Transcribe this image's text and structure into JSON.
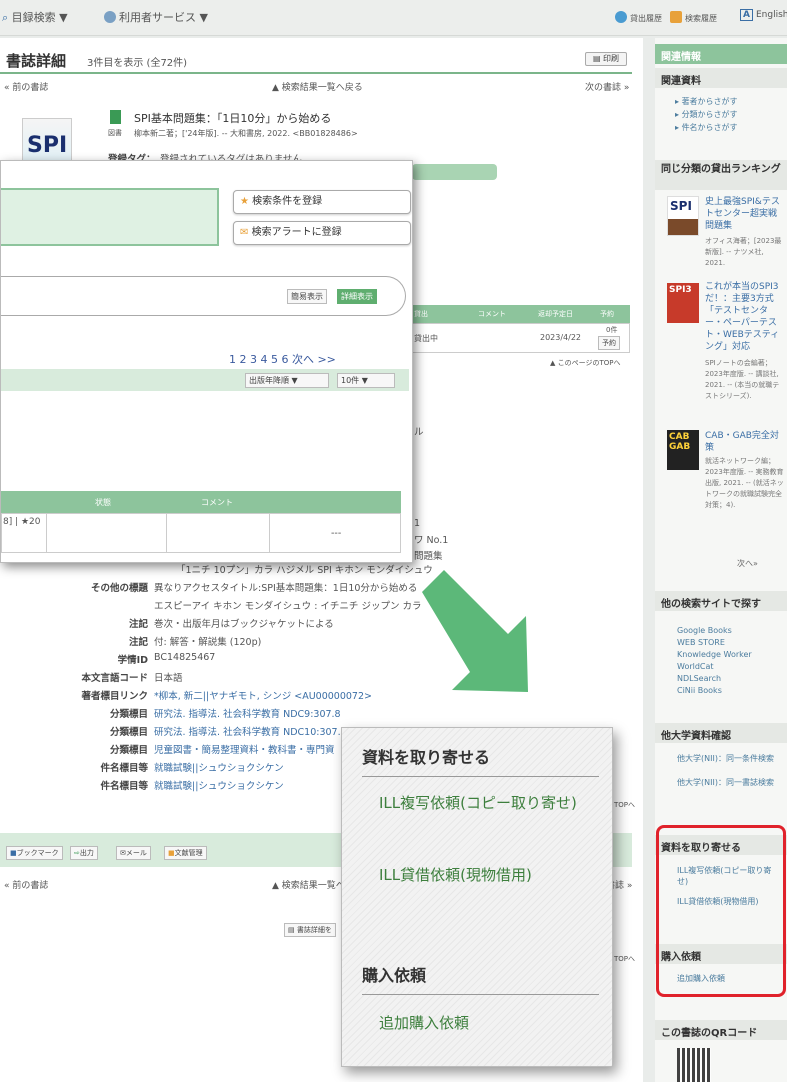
{
  "topbar": {
    "catalog_search": "目録検索 ▼",
    "user_services": "利用者サービス ▼",
    "history": "貸出履歴",
    "search_history": "検索履歴",
    "english": "English"
  },
  "header": {
    "title": "書誌詳細",
    "count": "3件目を表示 (全72件)",
    "print": "印刷"
  },
  "nav": {
    "prev": "前の書誌",
    "back": "検索結果一覧へ戻る",
    "next": "次の書誌"
  },
  "book": {
    "cover_text": "SPI",
    "title": "SPI基本問題集：「1日10分」から始める",
    "type": "図書",
    "line": "柳本新二著；['24年版]. -- 大和書房, 2022. <BB01828486>",
    "tag_label": "登録タグ：",
    "tag_value": "登録されているタグはありません"
  },
  "overlay": {
    "save_search": "検索条件を登録",
    "alert": "検索アラートに登録",
    "simple": "簡易表示",
    "detail": "詳細表示",
    "pages": "1  2  3  4  5  6  次へ  >>",
    "sort": "出版年降順",
    "per_page": "10件",
    "col_status": "状態",
    "col_comment": "コメント",
    "row_mark": "8] | ★20",
    "row_dash": "---"
  },
  "holdings": {
    "col_status": "状態",
    "col_comment": "コメント",
    "col_due": "返却予定日",
    "col_reserve": "予約",
    "status": "貸出中",
    "due": "2023/4/22",
    "count": "0件",
    "reserve": "予約",
    "top": "このページのTOPへ",
    "frag1": "ル",
    "frag2": "1",
    "frag3": "ワ No.1",
    "frag4": "問題集"
  },
  "details": {
    "yomi": "「1ニチ 10プン」カラ ハジメル SPI キホン モンダイシュウ",
    "rows": [
      {
        "label": "その他の標題",
        "value": "異なりアクセスタイトル:SPI基本問題集：1日10分から始める"
      },
      {
        "label": "",
        "value": "エスピーアイ キホン モンダイシュウ : イチニチ ジップン カラ"
      },
      {
        "label": "注記",
        "value": "巻次・出版年月はブックジャケットによる"
      },
      {
        "label": "注記",
        "value": "付: 解答・解説集 (120p)"
      },
      {
        "label": "学情ID",
        "value": "BC14825467"
      },
      {
        "label": "本文言語コード",
        "value": "日本語"
      },
      {
        "label": "著者標目リンク",
        "value": "*柳本, 新二||ヤナギモト, シンジ <AU00000072>"
      },
      {
        "label": "分類標目",
        "value": "研究法. 指導法. 社会科学教育 NDC9:307.8"
      },
      {
        "label": "分類標目",
        "value": "研究法. 指導法. 社会科学教育 NDC10:307.8"
      },
      {
        "label": "分類標目",
        "value": "児童図書・簡易整理資料・教科書・専門資"
      },
      {
        "label": "件名標目等",
        "value": "就職試験||シュウショクシケン"
      },
      {
        "label": "件名標目等",
        "value": "就職試験||シュウショクシケン"
      }
    ]
  },
  "footer": {
    "bookmark": "ブックマーク",
    "output": "出力",
    "mail": "メール",
    "reference": "文献管理",
    "prev": "前の書誌",
    "back": "検索結果一覧へ",
    "next": "書誌",
    "print": "書誌詳細を",
    "top1": "TOPへ",
    "top2": "TOPへ"
  },
  "sidebar": {
    "header": "関連情報",
    "related": "関連資料",
    "links": [
      "著者からさがす",
      "分類からさがす",
      "件名からさがす"
    ],
    "ranking": "同じ分類の貸出ランキング",
    "rank": [
      {
        "cover": "SPI",
        "title": "史上最強SPI&テストセンター超実戦問題集",
        "sub": "オフィス海著；[2023最新版]. -- ナツメ社, 2021."
      },
      {
        "cover": "SPI3",
        "title": "これが本当のSPI3だ！：主要3方式「テストセンター・ペーパーテスト・WEBテスティング」対応",
        "sub": "SPIノートの会編著；2023年度版. -- 講談社, 2021. -- (本当の就職テストシリーズ)."
      },
      {
        "cover": "CAB GAB",
        "title": "CAB・GAB完全対策",
        "sub": "就活ネットワーク編；2023年度版. -- 実務教育出版, 2021. -- (就活ネットワークの就職試験完全対策；4)."
      }
    ],
    "next": "次へ»",
    "other_sites": "他の検索サイトで探す",
    "sites": [
      "Google Books",
      "WEB STORE",
      "Knowledge Worker",
      "WorldCat",
      "NDLSearch",
      "CiNii Books"
    ],
    "other_univ": "他大学資料確認",
    "univ": [
      "他大学(NII)：同一条件検索",
      "他大学(NII)：同一書誌検索"
    ],
    "order": "資料を取り寄せる",
    "order_links": [
      "ILL複写依頼(コピー取り寄せ)",
      "ILL貸借依頼(現物借用)"
    ],
    "purchase": "購入依頼",
    "purchase_link": "追加購入依頼",
    "qr": "この書誌のQRコード"
  },
  "panel": {
    "order": "資料を取り寄せる",
    "copy": "ILL複写依頼(コピー取り寄せ)",
    "loan": "ILL貸借依頼(現物借用)",
    "purchase": "購入依頼",
    "purchase_link": "追加購入依頼"
  },
  "colors": {
    "green": "#7bb58a",
    "red": "#e0222b",
    "arrow": "#5cb879"
  }
}
